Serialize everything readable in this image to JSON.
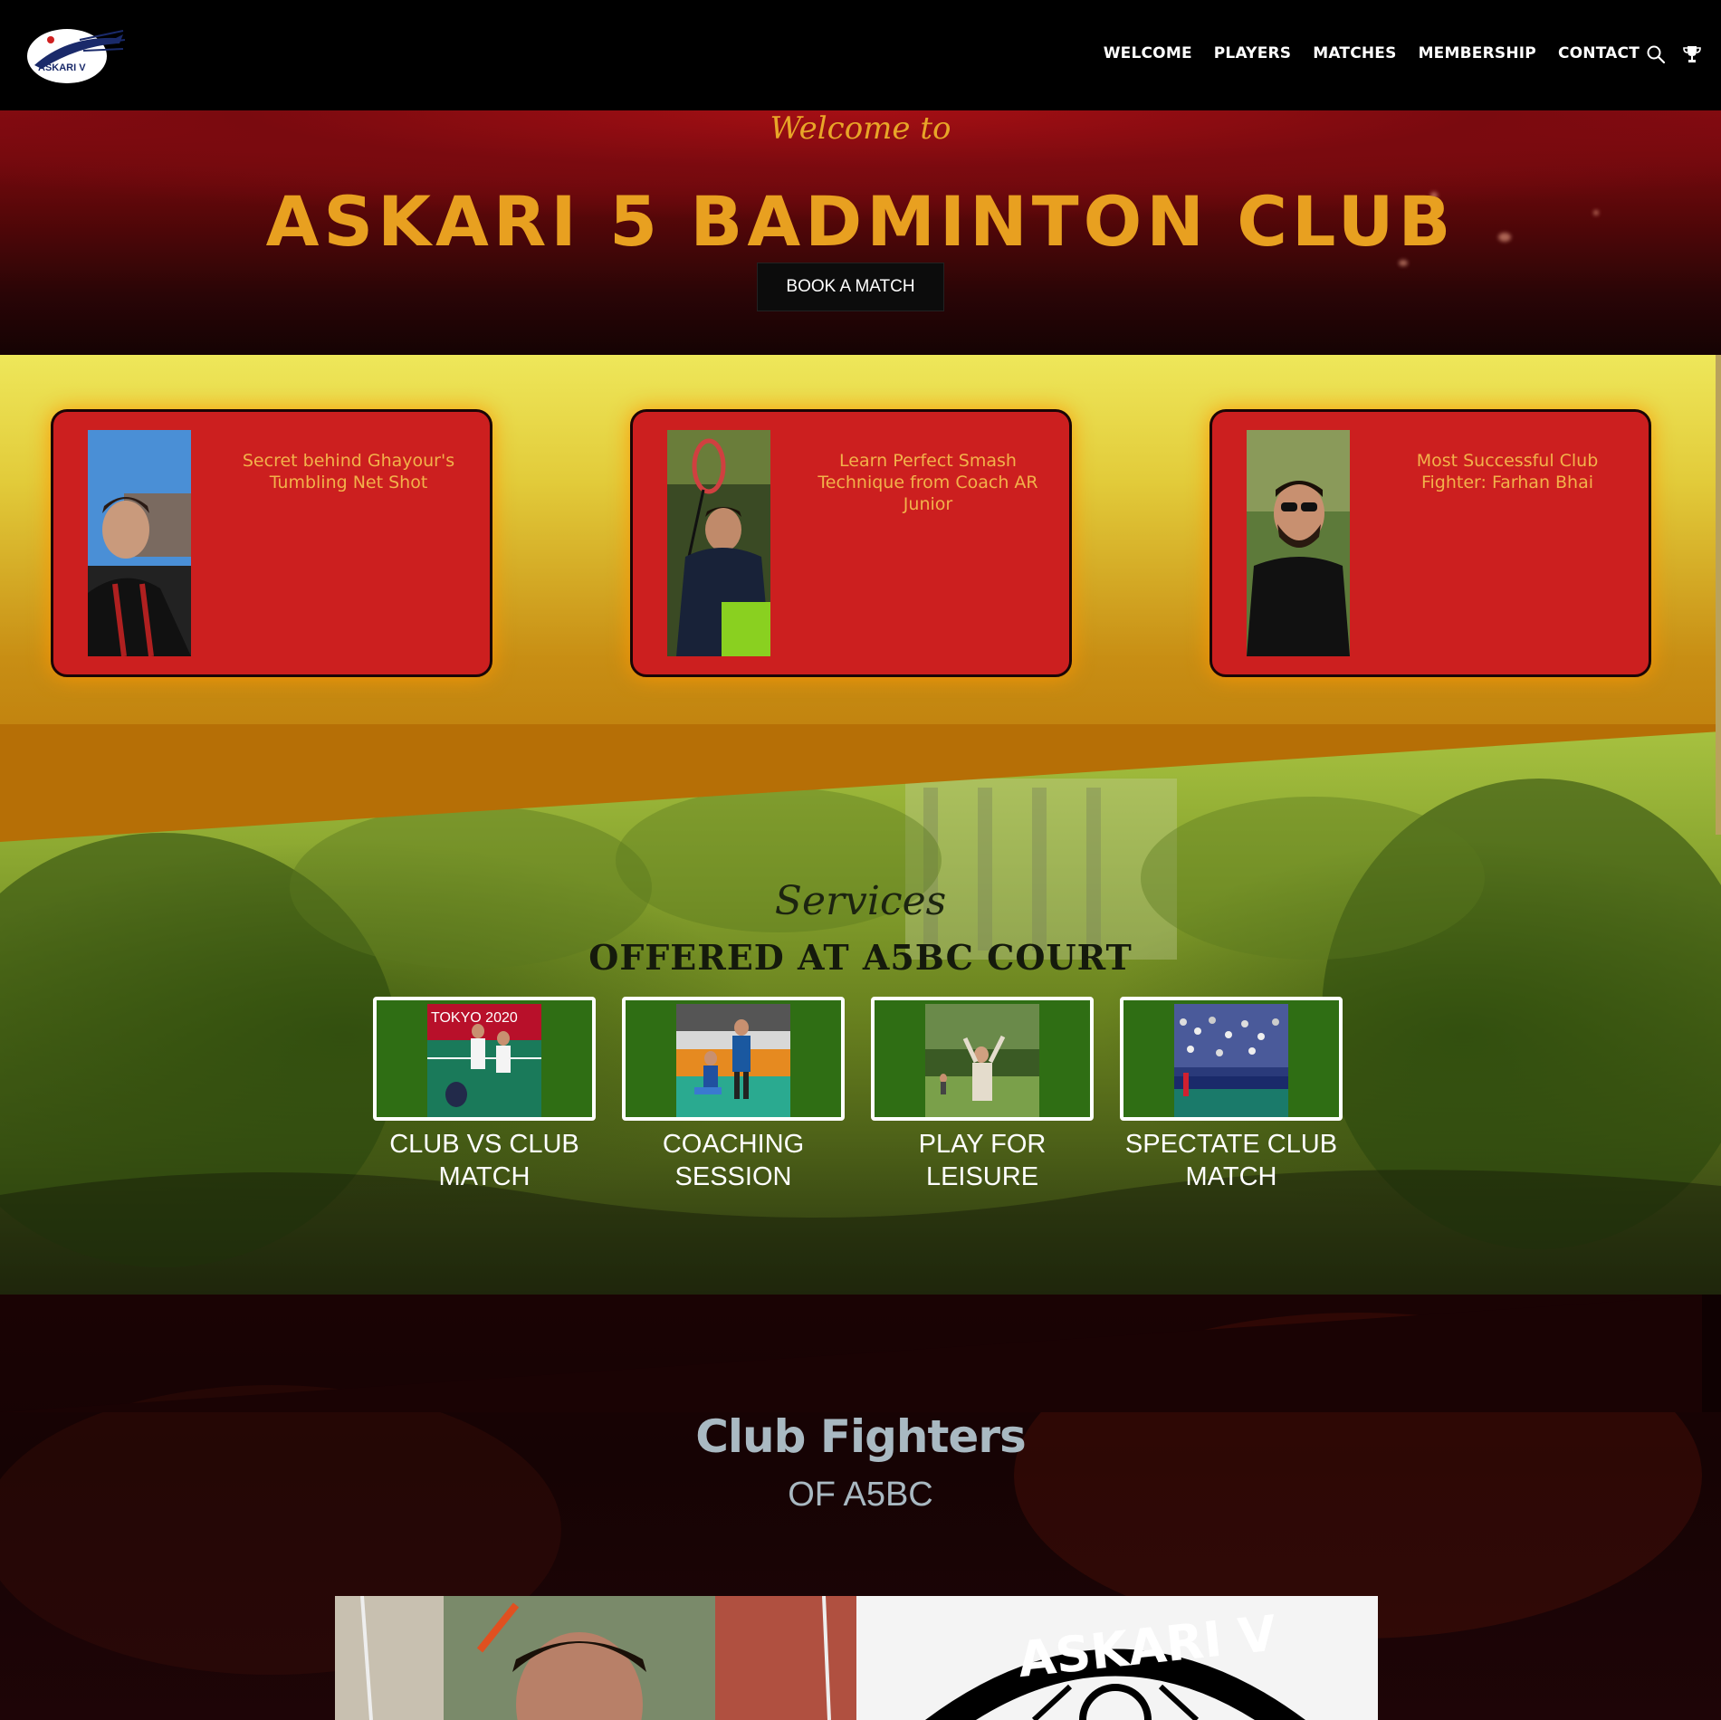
{
  "header": {
    "logo_text": "ASKARI V",
    "nav": [
      "WELCOME",
      "PLAYERS",
      "MATCHES",
      "MEMBERSHIP",
      "CONTACT"
    ],
    "icons": [
      "search-icon",
      "trophy-icon"
    ]
  },
  "hero": {
    "welcome": "Welcome to",
    "title": "ASKARI 5 BADMINTON CLUB",
    "button": "BOOK A MATCH"
  },
  "features": [
    {
      "text": "Secret behind Ghayour's Tumbling Net Shot"
    },
    {
      "text": "Learn Perfect Smash Technique from Coach AR Junior"
    },
    {
      "text": "Most Successful Club Fighter: Farhan Bhai"
    }
  ],
  "services": {
    "script": "Services",
    "title": "OFFERED AT A5BC COURT",
    "items": [
      {
        "label": "CLUB VS CLUB MATCH",
        "photo_text": "TOKYO 2020"
      },
      {
        "label": "COACHING SESSION"
      },
      {
        "label": "PLAY FOR LEISURE"
      },
      {
        "label": "SPECTATE CLUB MATCH"
      }
    ]
  },
  "fighters": {
    "title": "Club Fighters",
    "subtitle": "OF A5BC",
    "logo_text": "ASKARI V"
  },
  "colors": {
    "accent_gold": "#e8a020",
    "card_red": "#cc1f1f",
    "header_bg": "#000000"
  }
}
